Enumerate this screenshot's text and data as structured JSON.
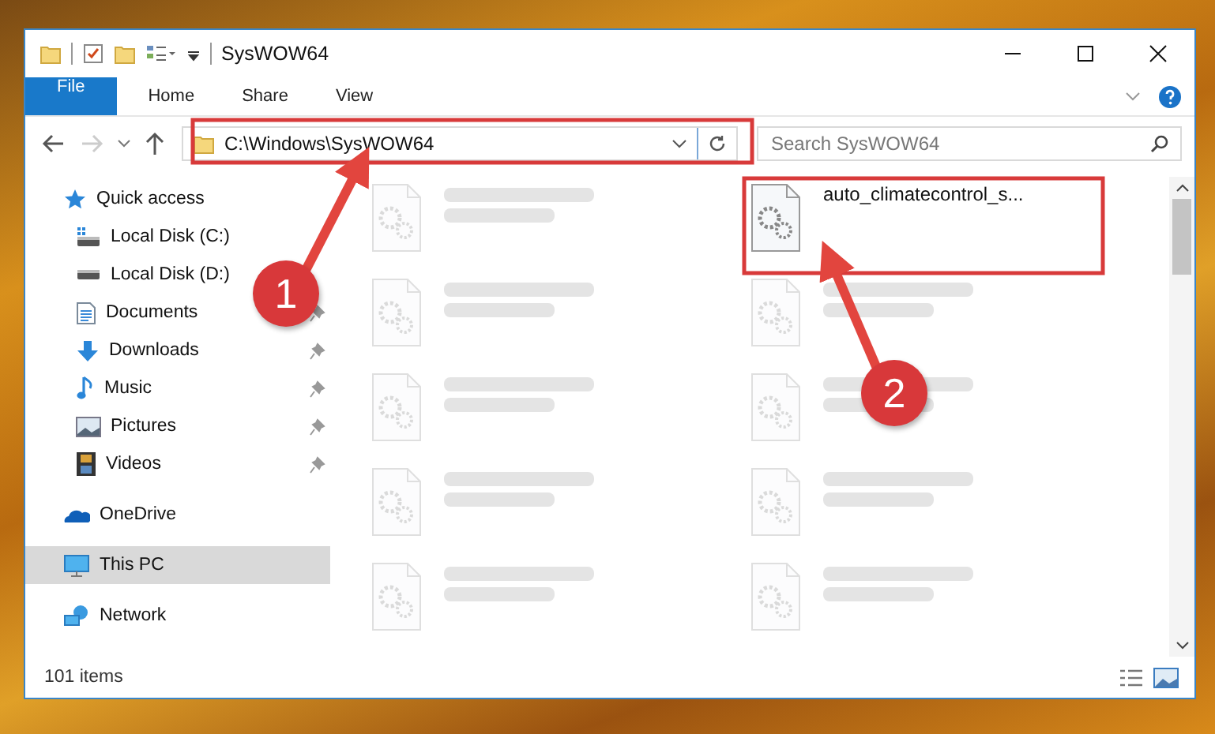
{
  "window": {
    "title": "SysWOW64"
  },
  "ribbon_tabs": [
    {
      "label": "File",
      "selected": true
    },
    {
      "label": "Home",
      "selected": false
    },
    {
      "label": "Share",
      "selected": false
    },
    {
      "label": "View",
      "selected": false
    }
  ],
  "address": {
    "value": "C:\\Windows\\SysWOW64"
  },
  "search": {
    "placeholder": "Search SysWOW64"
  },
  "navigation": [
    {
      "label": "Quick access",
      "selected": false,
      "children": [
        {
          "label": "Local Disk (C:)",
          "pinned": false,
          "selected": false
        },
        {
          "label": "Local Disk (D:)",
          "pinned": false,
          "selected": false
        },
        {
          "label": "Documents",
          "pinned": true,
          "selected": false
        },
        {
          "label": "Downloads",
          "pinned": true,
          "selected": false
        },
        {
          "label": "Music",
          "pinned": true,
          "selected": false
        },
        {
          "label": "Pictures",
          "pinned": true,
          "selected": false
        },
        {
          "label": "Videos",
          "pinned": true,
          "selected": false
        }
      ]
    },
    {
      "label": "OneDrive",
      "selected": false
    },
    {
      "label": "This PC",
      "selected": true
    },
    {
      "label": "Network",
      "selected": false
    }
  ],
  "files": [
    {
      "faded": true
    },
    {
      "name": "auto_climatecontrol_s...",
      "faded": false
    },
    {
      "faded": true
    },
    {
      "faded": true
    },
    {
      "faded": true
    },
    {
      "faded": true
    },
    {
      "faded": true
    },
    {
      "faded": true
    },
    {
      "faded": true
    },
    {
      "faded": true
    }
  ],
  "status_bar": {
    "item_count": "101 items"
  },
  "annotations": [
    {
      "kind": "badge-arrow",
      "label": "1"
    },
    {
      "kind": "badge-arrow",
      "label": "2"
    }
  ]
}
